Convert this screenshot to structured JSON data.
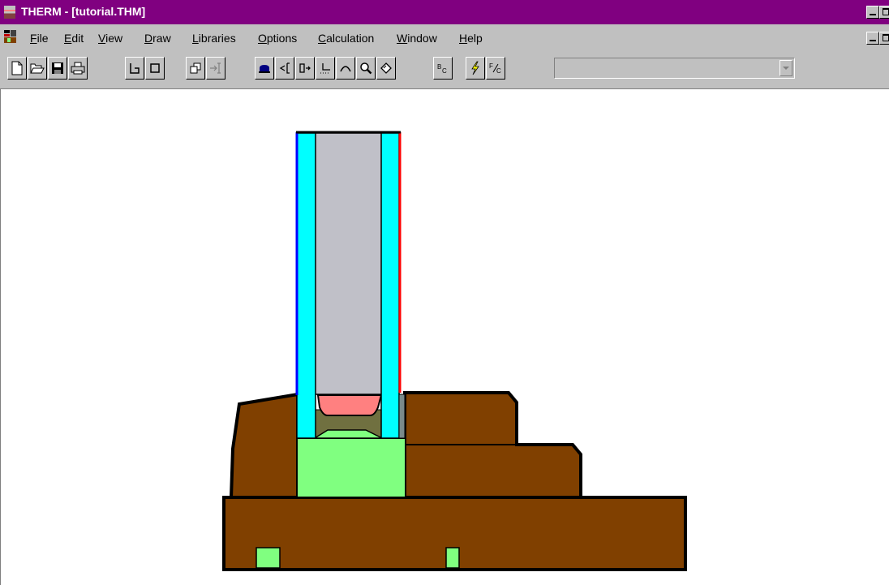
{
  "window": {
    "title": "THERM - [tutorial.THM]",
    "title_bar_color": "#800080"
  },
  "title_bar_controls": [
    "minimize-button",
    "restore-button"
  ],
  "menubar": {
    "items": [
      {
        "label": "File",
        "mnemonic": "F"
      },
      {
        "label": "Edit",
        "mnemonic": "E"
      },
      {
        "label": "View",
        "mnemonic": "V"
      },
      {
        "label": "Draw",
        "mnemonic": "D"
      },
      {
        "label": "Libraries",
        "mnemonic": "L"
      },
      {
        "label": "Options",
        "mnemonic": "O"
      },
      {
        "label": "Calculation",
        "mnemonic": "C"
      },
      {
        "label": "Window",
        "mnemonic": "W"
      },
      {
        "label": "Help",
        "mnemonic": "H"
      }
    ]
  },
  "toolbar": {
    "buttons": [
      {
        "icon": "new-file-icon"
      },
      {
        "icon": "open-folder-icon"
      },
      {
        "icon": "save-icon"
      },
      {
        "icon": "print-icon"
      },
      {
        "icon": "polygon-draw-icon"
      },
      {
        "icon": "rectangle-draw-icon"
      },
      {
        "icon": "fill-void-icon"
      },
      {
        "icon": "locator-icon"
      },
      {
        "icon": "material-fill-icon"
      },
      {
        "icon": "insert-point-icon"
      },
      {
        "icon": "move-point-icon"
      },
      {
        "icon": "dimension-icon"
      },
      {
        "icon": "arc-icon"
      },
      {
        "icon": "zoom-icon"
      },
      {
        "icon": "rotate-icon"
      },
      {
        "icon": "boundary-condition-icon"
      },
      {
        "icon": "calculate-icon"
      },
      {
        "icon": "ufactor-icon"
      }
    ],
    "material_combo_value": ""
  },
  "drawing": {
    "materials": {
      "frame": "#804000",
      "glazing": "#00ffff",
      "gas_fill": "#c0c0c8",
      "spacer": "#ff8080",
      "sealant": "#707040",
      "thermal_break": "#80ff80",
      "edge_dark": "#7a8a8a",
      "boundary_exterior": "#0000ff",
      "boundary_interior": "#ff0000",
      "outline": "#000000"
    }
  }
}
